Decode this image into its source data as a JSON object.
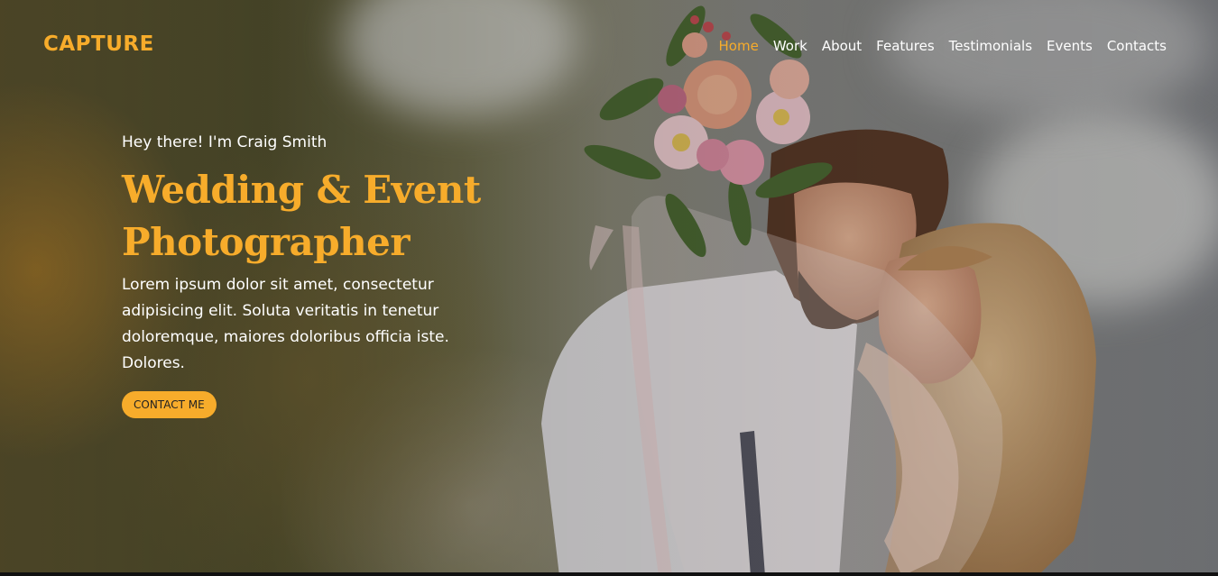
{
  "brand": {
    "name": "CAPTURE"
  },
  "nav": {
    "items": [
      {
        "label": "Home",
        "active": true
      },
      {
        "label": "Work"
      },
      {
        "label": "About"
      },
      {
        "label": "Features"
      },
      {
        "label": "Testimonials"
      },
      {
        "label": "Events"
      },
      {
        "label": "Contacts"
      }
    ]
  },
  "hero": {
    "greeting": "Hey there! I'm Craig Smith",
    "headline_line1": "Wedding & Event",
    "headline_line2": "Photographer",
    "description": "Lorem ipsum dolor sit amet, consectetur adipisicing elit. Soluta veritatis in tenetur doloremque, maiores doloribus officia iste. Dolores.",
    "cta_label": "CONTACT ME"
  },
  "colors": {
    "accent": "#f7ac2b",
    "text": "#ffffff"
  }
}
